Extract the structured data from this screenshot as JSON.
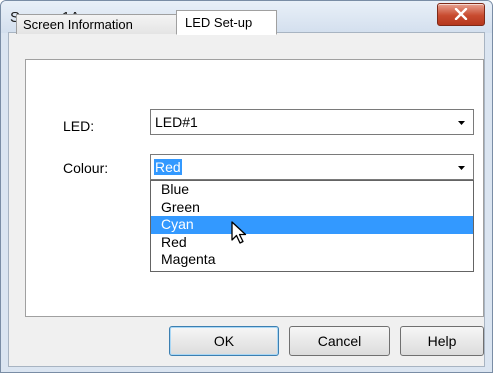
{
  "window": {
    "title": "Screen 1A"
  },
  "tabs": [
    {
      "label": "Screen Information"
    },
    {
      "label": "LED Set-up"
    }
  ],
  "form": {
    "led_label": "LED:",
    "led_value": "LED#1",
    "colour_label": "Colour:",
    "colour_value": "Red"
  },
  "dropdown": {
    "options": [
      "Blue",
      "Green",
      "Cyan",
      "Red",
      "Magenta"
    ],
    "highlighted": "Cyan"
  },
  "buttons": {
    "ok": "OK",
    "cancel": "Cancel",
    "help": "Help"
  },
  "icons": {
    "close": "close-icon",
    "arrow": "chevron-down-icon",
    "cursor": "mouse-pointer-icon"
  },
  "colors": {
    "selection": "#3399ff",
    "close": "#c84b2f"
  }
}
